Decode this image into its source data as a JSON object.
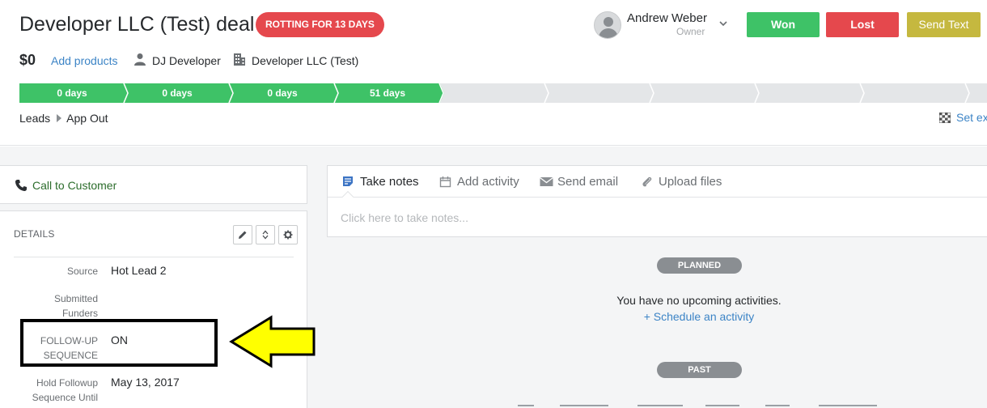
{
  "deal": {
    "title": "Developer LLC (Test) deal",
    "rotting_badge": "ROTTING FOR 13 DAYS",
    "value": "$0",
    "add_products": "Add products",
    "person": "DJ Developer",
    "organization": "Developer LLC (Test)"
  },
  "owner": {
    "name": "Andrew Weber",
    "role": "Owner"
  },
  "actions": {
    "won": "Won",
    "lost": "Lost",
    "send_text": "Send Text"
  },
  "pipeline": {
    "stages": [
      {
        "label": "0 days",
        "done": true
      },
      {
        "label": "0 days",
        "done": true
      },
      {
        "label": "0 days",
        "done": true
      },
      {
        "label": "51 days",
        "done": true
      },
      {
        "label": "",
        "done": false
      },
      {
        "label": "",
        "done": false
      },
      {
        "label": "",
        "done": false
      },
      {
        "label": "",
        "done": false
      },
      {
        "label": "",
        "done": false
      },
      {
        "label": "",
        "done": false
      }
    ],
    "colors": {
      "done": "#3ec267",
      "todo": "#e4e6e8"
    }
  },
  "breadcrumb": {
    "pipeline": "Leads",
    "stage": "App Out"
  },
  "set_expected": "Set ex",
  "call_card": {
    "label": "Call to Customer"
  },
  "details": {
    "title": "DETAILS",
    "fields": [
      {
        "label_lines": [
          "Source"
        ],
        "value": "Hot Lead 2"
      },
      {
        "label_lines": [
          "Submitted",
          "Funders"
        ],
        "value": ""
      },
      {
        "label_lines": [
          "FOLLOW-UP",
          "SEQUENCE"
        ],
        "value": "ON"
      },
      {
        "label_lines": [
          "Hold Followup",
          "Sequence Until"
        ],
        "value": "May 13, 2017"
      }
    ]
  },
  "composer": {
    "tabs": [
      {
        "label": "Take notes",
        "icon": "note-icon",
        "active": true
      },
      {
        "label": "Add activity",
        "icon": "calendar-icon",
        "active": false
      },
      {
        "label": "Send email",
        "icon": "envelope-icon",
        "active": false
      },
      {
        "label": "Upload files",
        "icon": "paperclip-icon",
        "active": false
      }
    ],
    "placeholder": "Click here to take notes..."
  },
  "timeline": {
    "planned_label": "PLANNED",
    "empty_message": "You have no upcoming activities.",
    "schedule_link": "+ Schedule an activity",
    "past_label": "PAST"
  },
  "colors": {
    "won": "#3ec267",
    "lost": "#e5484d",
    "send_text": "#c5b83f",
    "link": "#3c84c6",
    "annotation_arrow": "#ffff00"
  }
}
